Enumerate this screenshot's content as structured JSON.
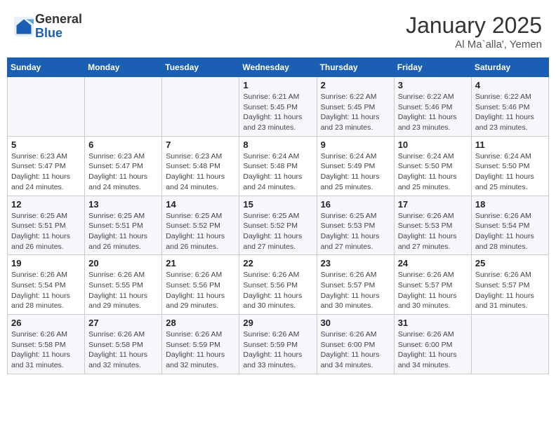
{
  "header": {
    "logo_general": "General",
    "logo_blue": "Blue",
    "month_title": "January 2025",
    "location": "Al Ma`alla', Yemen"
  },
  "days_of_week": [
    "Sunday",
    "Monday",
    "Tuesday",
    "Wednesday",
    "Thursday",
    "Friday",
    "Saturday"
  ],
  "weeks": [
    [
      {
        "day": "",
        "info": ""
      },
      {
        "day": "",
        "info": ""
      },
      {
        "day": "",
        "info": ""
      },
      {
        "day": "1",
        "info": "Sunrise: 6:21 AM\nSunset: 5:45 PM\nDaylight: 11 hours\nand 23 minutes."
      },
      {
        "day": "2",
        "info": "Sunrise: 6:22 AM\nSunset: 5:45 PM\nDaylight: 11 hours\nand 23 minutes."
      },
      {
        "day": "3",
        "info": "Sunrise: 6:22 AM\nSunset: 5:46 PM\nDaylight: 11 hours\nand 23 minutes."
      },
      {
        "day": "4",
        "info": "Sunrise: 6:22 AM\nSunset: 5:46 PM\nDaylight: 11 hours\nand 23 minutes."
      }
    ],
    [
      {
        "day": "5",
        "info": "Sunrise: 6:23 AM\nSunset: 5:47 PM\nDaylight: 11 hours\nand 24 minutes."
      },
      {
        "day": "6",
        "info": "Sunrise: 6:23 AM\nSunset: 5:47 PM\nDaylight: 11 hours\nand 24 minutes."
      },
      {
        "day": "7",
        "info": "Sunrise: 6:23 AM\nSunset: 5:48 PM\nDaylight: 11 hours\nand 24 minutes."
      },
      {
        "day": "8",
        "info": "Sunrise: 6:24 AM\nSunset: 5:48 PM\nDaylight: 11 hours\nand 24 minutes."
      },
      {
        "day": "9",
        "info": "Sunrise: 6:24 AM\nSunset: 5:49 PM\nDaylight: 11 hours\nand 25 minutes."
      },
      {
        "day": "10",
        "info": "Sunrise: 6:24 AM\nSunset: 5:50 PM\nDaylight: 11 hours\nand 25 minutes."
      },
      {
        "day": "11",
        "info": "Sunrise: 6:24 AM\nSunset: 5:50 PM\nDaylight: 11 hours\nand 25 minutes."
      }
    ],
    [
      {
        "day": "12",
        "info": "Sunrise: 6:25 AM\nSunset: 5:51 PM\nDaylight: 11 hours\nand 26 minutes."
      },
      {
        "day": "13",
        "info": "Sunrise: 6:25 AM\nSunset: 5:51 PM\nDaylight: 11 hours\nand 26 minutes."
      },
      {
        "day": "14",
        "info": "Sunrise: 6:25 AM\nSunset: 5:52 PM\nDaylight: 11 hours\nand 26 minutes."
      },
      {
        "day": "15",
        "info": "Sunrise: 6:25 AM\nSunset: 5:52 PM\nDaylight: 11 hours\nand 27 minutes."
      },
      {
        "day": "16",
        "info": "Sunrise: 6:25 AM\nSunset: 5:53 PM\nDaylight: 11 hours\nand 27 minutes."
      },
      {
        "day": "17",
        "info": "Sunrise: 6:26 AM\nSunset: 5:53 PM\nDaylight: 11 hours\nand 27 minutes."
      },
      {
        "day": "18",
        "info": "Sunrise: 6:26 AM\nSunset: 5:54 PM\nDaylight: 11 hours\nand 28 minutes."
      }
    ],
    [
      {
        "day": "19",
        "info": "Sunrise: 6:26 AM\nSunset: 5:54 PM\nDaylight: 11 hours\nand 28 minutes."
      },
      {
        "day": "20",
        "info": "Sunrise: 6:26 AM\nSunset: 5:55 PM\nDaylight: 11 hours\nand 29 minutes."
      },
      {
        "day": "21",
        "info": "Sunrise: 6:26 AM\nSunset: 5:56 PM\nDaylight: 11 hours\nand 29 minutes."
      },
      {
        "day": "22",
        "info": "Sunrise: 6:26 AM\nSunset: 5:56 PM\nDaylight: 11 hours\nand 30 minutes."
      },
      {
        "day": "23",
        "info": "Sunrise: 6:26 AM\nSunset: 5:57 PM\nDaylight: 11 hours\nand 30 minutes."
      },
      {
        "day": "24",
        "info": "Sunrise: 6:26 AM\nSunset: 5:57 PM\nDaylight: 11 hours\nand 30 minutes."
      },
      {
        "day": "25",
        "info": "Sunrise: 6:26 AM\nSunset: 5:57 PM\nDaylight: 11 hours\nand 31 minutes."
      }
    ],
    [
      {
        "day": "26",
        "info": "Sunrise: 6:26 AM\nSunset: 5:58 PM\nDaylight: 11 hours\nand 31 minutes."
      },
      {
        "day": "27",
        "info": "Sunrise: 6:26 AM\nSunset: 5:58 PM\nDaylight: 11 hours\nand 32 minutes."
      },
      {
        "day": "28",
        "info": "Sunrise: 6:26 AM\nSunset: 5:59 PM\nDaylight: 11 hours\nand 32 minutes."
      },
      {
        "day": "29",
        "info": "Sunrise: 6:26 AM\nSunset: 5:59 PM\nDaylight: 11 hours\nand 33 minutes."
      },
      {
        "day": "30",
        "info": "Sunrise: 6:26 AM\nSunset: 6:00 PM\nDaylight: 11 hours\nand 34 minutes."
      },
      {
        "day": "31",
        "info": "Sunrise: 6:26 AM\nSunset: 6:00 PM\nDaylight: 11 hours\nand 34 minutes."
      },
      {
        "day": "",
        "info": ""
      }
    ]
  ]
}
